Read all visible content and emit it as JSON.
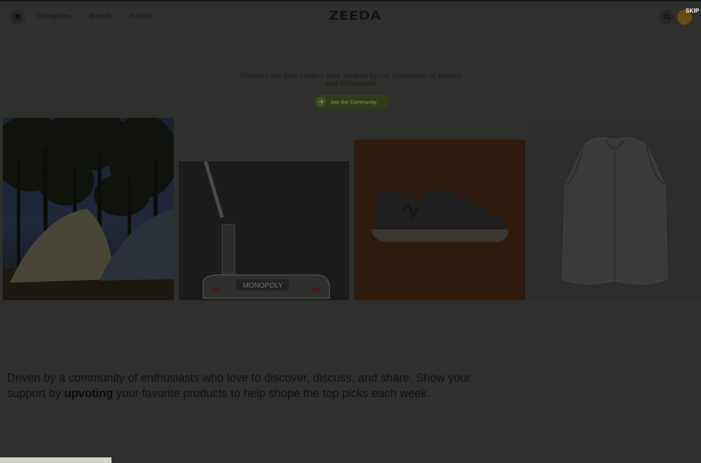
{
  "nav": {
    "links": [
      "Categories",
      "Brands",
      "Submit"
    ],
    "logo": "ZEEDA",
    "skip": "SKIP",
    "icons": {
      "home": "home-icon",
      "search": "search-icon"
    }
  },
  "hero": {
    "subtitle": "Discover the best outdoor gear curated by our community of experts and enthusiasts",
    "cta": "Join the Community"
  },
  "products": [
    {
      "name": "tent-image"
    },
    {
      "name": "putter-image",
      "text": "MONOPOLY"
    },
    {
      "name": "sneaker-image"
    },
    {
      "name": "vest-image"
    }
  ],
  "mission": {
    "before": "Driven by a community of enthusiasts who love to discover, discuss, and share. Show your support by ",
    "emphasis": "upvoting",
    "after": " your favorite products to help shope the top picks each week."
  },
  "colors": {
    "overlay_bg": "#2f2f2d",
    "cta_bg": "#2e3d16",
    "avatar": "#6b4a14"
  }
}
